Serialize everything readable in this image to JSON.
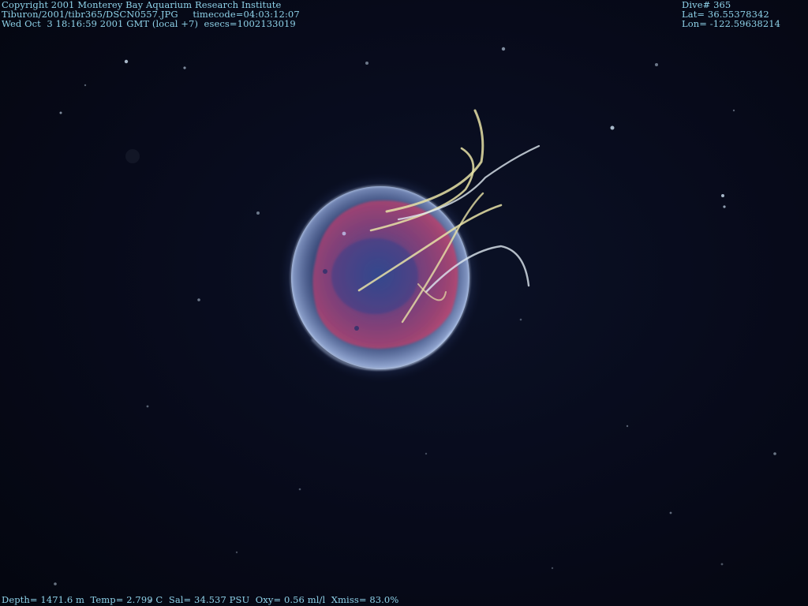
{
  "overlay": {
    "copyright": "Copyright 2001 Monterey Bay Aquarium Research Institute",
    "file_line": "Tiburon/2001/tibr365/DSCN0557.JPG     timecode=04:03:12:07",
    "date_line": "Wed Oct  3 18:16:59 2001 GMT (local +7)  esecs=1002133019",
    "dive": "Dive# 365",
    "lat": "Lat= 36.55378342",
    "lon": "Lon= -122.59638214",
    "sensors": "Depth= 1471.6 m  Temp= 2.799 C  Sal= 34.537 PSU  Oxy= 0.56 ml/l  Xmiss= 83.0%"
  },
  "photo": {
    "subject": "jellyfish",
    "background_color": "#070b1c",
    "bell_color": "#a9c7ff",
    "gut_color": "#b23a6a",
    "tentacle_color": "#e8e2a6",
    "overlay_text_color": "#8fd3ea"
  }
}
